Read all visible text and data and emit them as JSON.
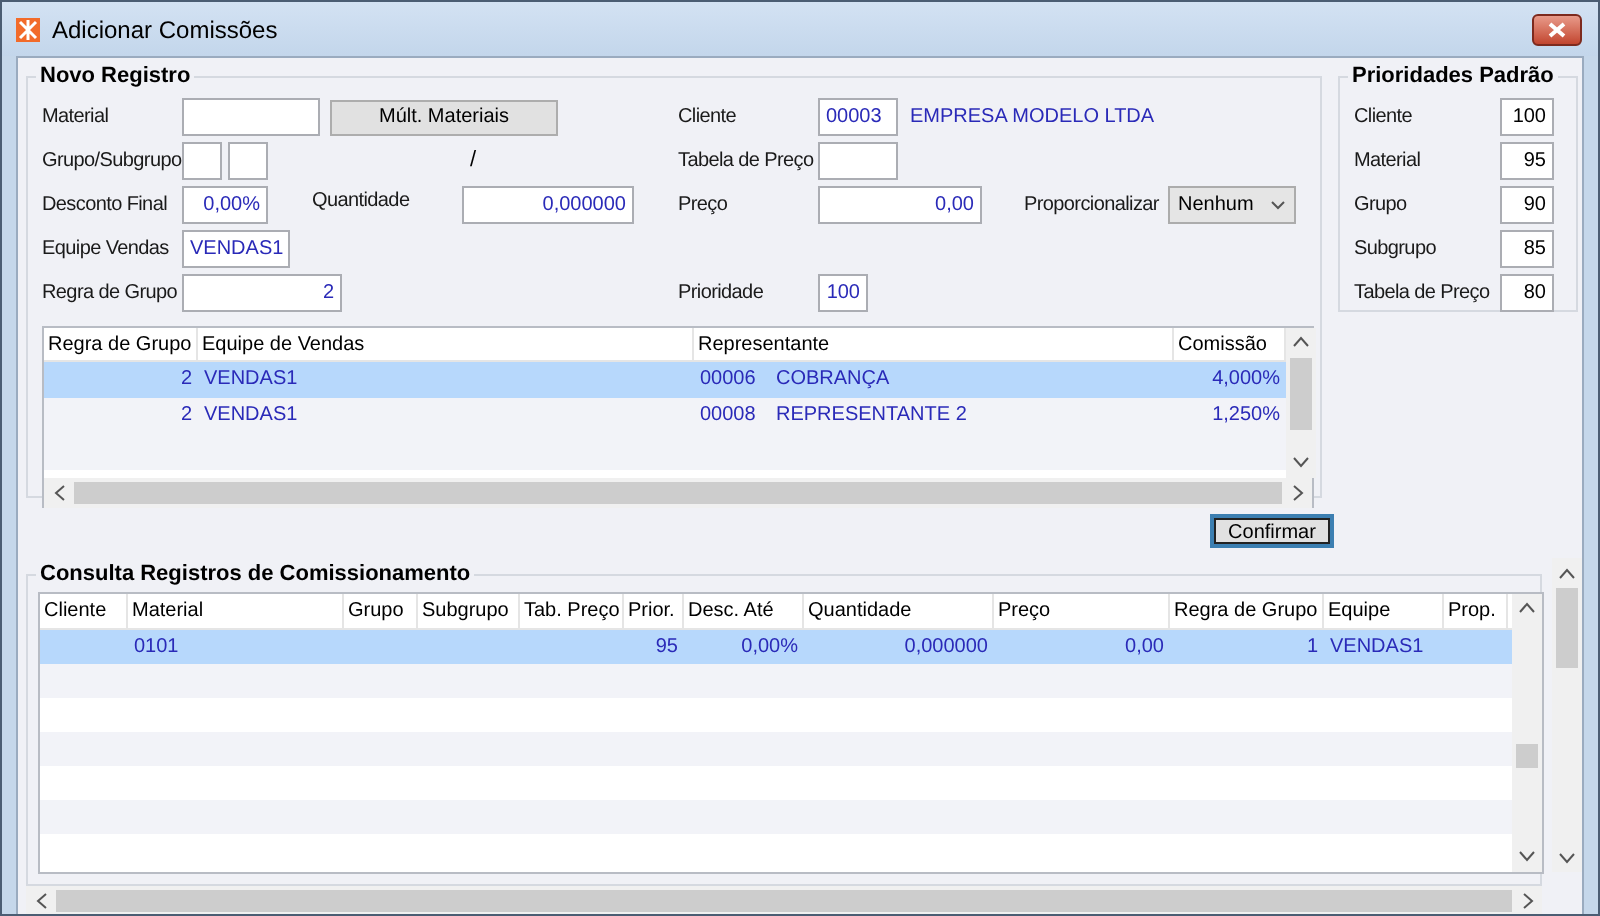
{
  "window": {
    "title": "Adicionar Comissões"
  },
  "novo_registro": {
    "title": "Novo Registro",
    "material": {
      "label": "Material"
    },
    "multi_button": "Múlt. Materiais",
    "cliente": {
      "label": "Cliente",
      "value": "00003",
      "name": "EMPRESA MODELO LTDA"
    },
    "grupo_subgrupo": {
      "label": "Grupo/Subgrupo",
      "separator": "/"
    },
    "tabela_preco": {
      "label": "Tabela de Preço"
    },
    "desconto_final": {
      "label": "Desconto Final",
      "value": "0,00%"
    },
    "quantidade": {
      "label": "Quantidade",
      "value": "0,000000"
    },
    "preco": {
      "label": "Preço",
      "value": "0,00"
    },
    "proporcionalizar": {
      "label": "Proporcionalizar",
      "value": "Nenhum"
    },
    "equipe_vendas": {
      "label": "Equipe Vendas",
      "value": "VENDAS1"
    },
    "regra_grupo": {
      "label": "Regra de Grupo",
      "value": "2"
    },
    "prioridade": {
      "label": "Prioridade",
      "value": "100"
    },
    "table": {
      "columns": [
        "Regra de Grupo",
        "Equipe de Vendas",
        "Representante",
        "Comissão"
      ],
      "rows": [
        {
          "selected": true,
          "cells": [
            "2",
            "VENDAS1",
            {
              "code": "00006",
              "name": "COBRANÇA"
            },
            "4,000%"
          ]
        },
        {
          "selected": false,
          "cells": [
            "2",
            "VENDAS1",
            {
              "code": "00008",
              "name": "REPRESENTANTE 2"
            },
            "1,250%"
          ]
        }
      ]
    }
  },
  "prioridades_padrao": {
    "title": "Prioridades Padrão",
    "items": [
      {
        "label": "Cliente",
        "value": "100"
      },
      {
        "label": "Material",
        "value": "95"
      },
      {
        "label": "Grupo",
        "value": "90"
      },
      {
        "label": "Subgrupo",
        "value": "85"
      },
      {
        "label": "Tabela de Preço",
        "value": "80"
      }
    ]
  },
  "confirm_button": "Confirmar",
  "consulta": {
    "title": "Consulta Registros de Comissionamento",
    "table": {
      "columns": [
        "Cliente",
        "Material",
        "Grupo",
        "Subgrupo",
        "Tab. Preço",
        "Prior.",
        "Desc. Até",
        "Quantidade",
        "Preço",
        "Regra de Grupo",
        "Equipe",
        "Prop."
      ],
      "rows": [
        {
          "selected": true,
          "cells": [
            null,
            "0101",
            null,
            null,
            null,
            "95",
            "0,00%",
            "0,000000",
            "0,00",
            "1",
            "VENDAS1",
            null
          ]
        }
      ]
    }
  }
}
